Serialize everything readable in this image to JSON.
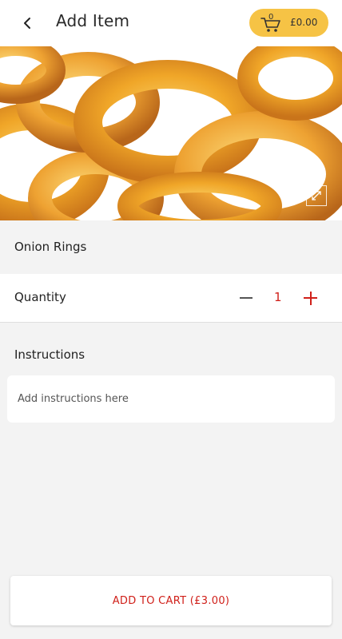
{
  "header": {
    "title": "Add Item",
    "back_icon": "chevron-left-icon",
    "cart": {
      "icon": "cart-icon",
      "count": "0",
      "total": "£0.00",
      "color": "#f6c345"
    }
  },
  "product": {
    "image_alt": "Onion Rings",
    "expand_icon": "expand-icon",
    "name": "Onion Rings"
  },
  "quantity": {
    "label": "Quantity",
    "value": "1",
    "minus_icon": "minus-icon",
    "plus_icon": "plus-icon",
    "accent": "#d0201a"
  },
  "instructions": {
    "label": "Instructions",
    "placeholder": "Add instructions here",
    "value": ""
  },
  "footer": {
    "add_button_label": "ADD TO CART (£3.00)"
  }
}
